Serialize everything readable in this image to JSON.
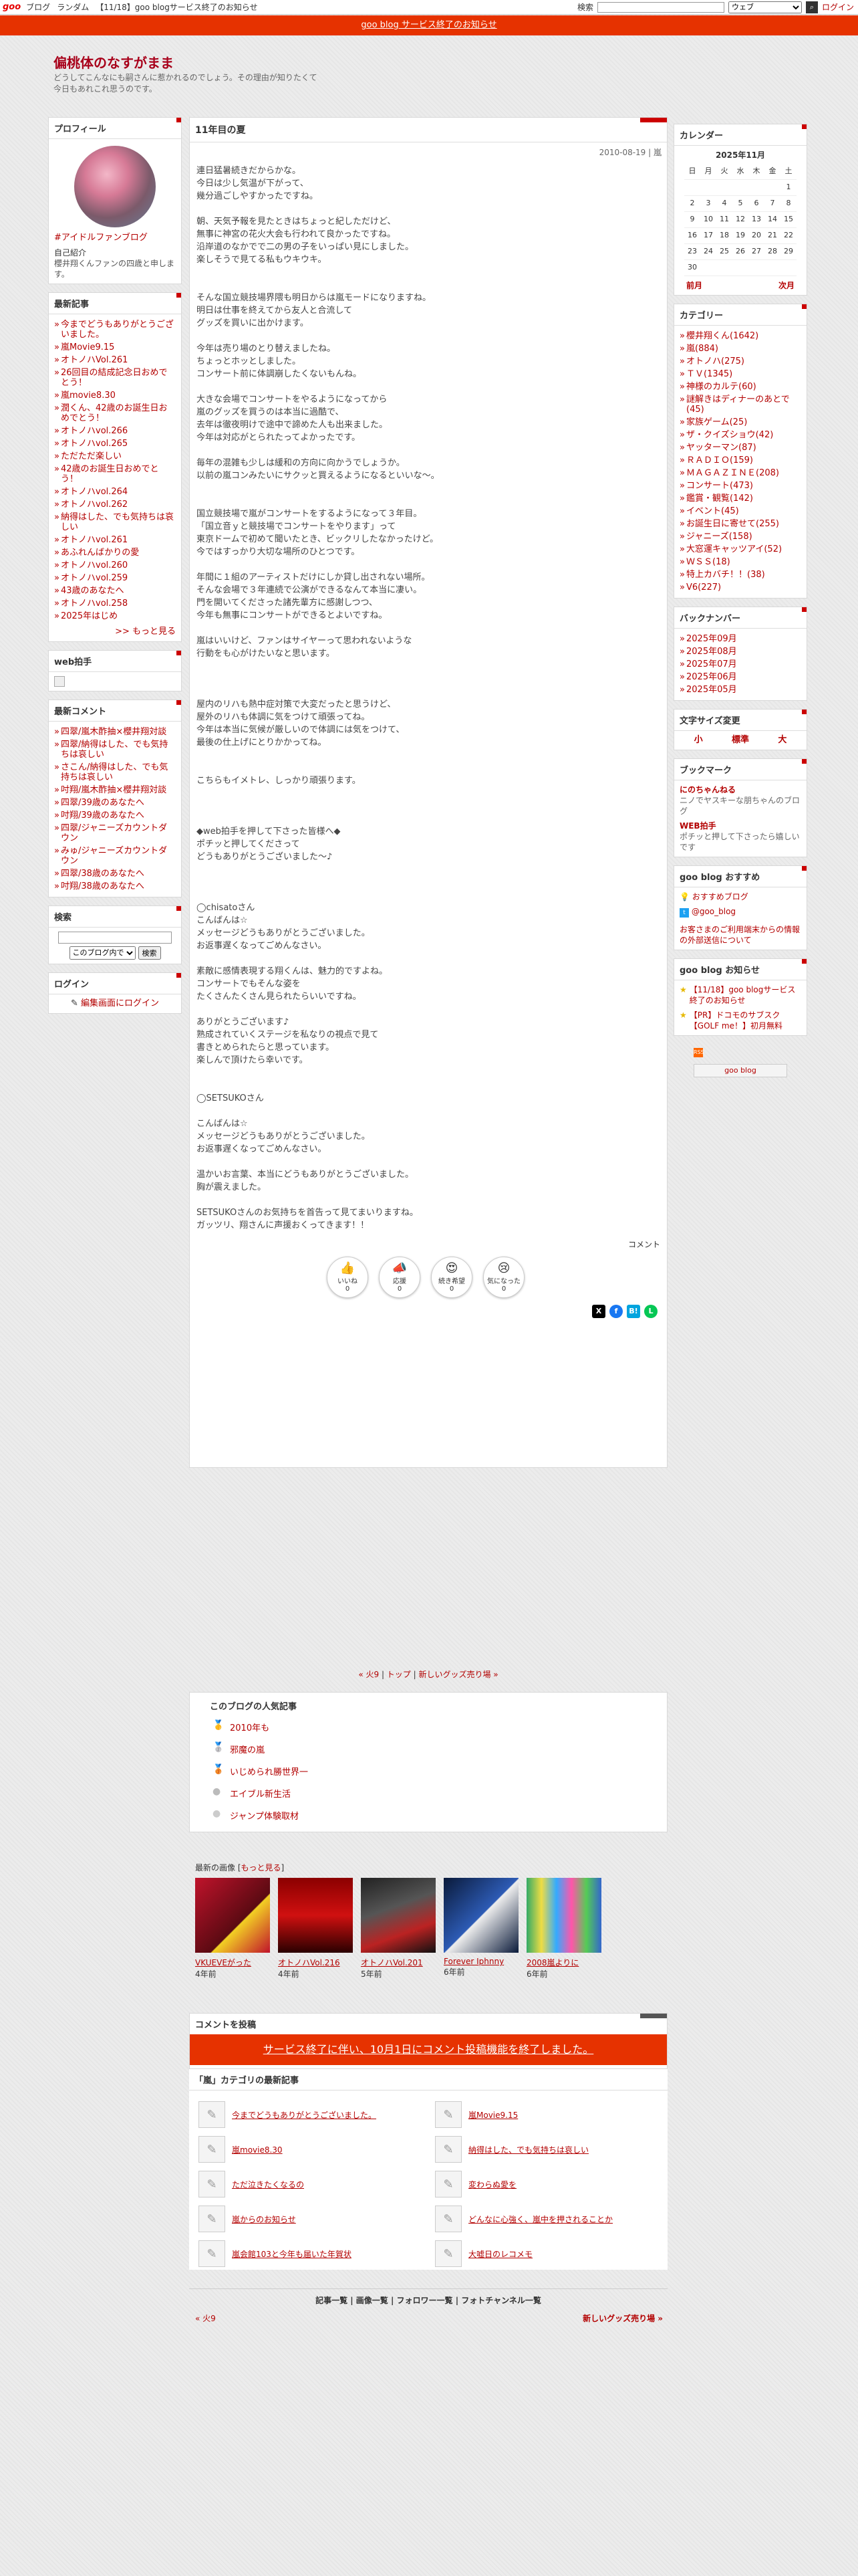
{
  "topbar": {
    "logo": "goo",
    "nav": [
      "ブログ",
      "ランダム",
      "【11/18】goo blogサービス終了のお知らせ"
    ],
    "search_label": "検索",
    "web_option": "ウェブ",
    "login": "ログイン"
  },
  "notice": "goo blog サービス終了のお知らせ",
  "blog": {
    "title": "偏桃体のなすがまま",
    "description": "どうしてこんなにも嗣さんに惹かれるのでしょう。その理由が知りたくて今日もあれこれ思うのです。"
  },
  "profile": {
    "heading": "プロフィール",
    "fanclub": "#アイドルファンブログ",
    "intro_heading": "自己紹介",
    "intro": "櫻井翔くんファンの四歳と申します。"
  },
  "latest": {
    "heading": "最新記事",
    "items": [
      "今までどうもありがとうございました。",
      "嵐Movie9.15",
      "オトノハVol.261",
      "26回目の結成記念日おめでとう！",
      "嵐movie8.30",
      "潤くん、42歳のお誕生日おめでとう！",
      "オトノハvol.266",
      "オトノハvol.265",
      "ただただ楽しい",
      "42歳のお誕生日おめでとう！",
      "オトノハvol.264",
      "オトノハvol.262",
      "納得はした、でも気持ちは哀しい",
      "オトノハvol.261",
      "あふれんばかりの愛",
      "オトノハvol.260",
      "オトノハvol.259",
      "43歳のあなたへ",
      "オトノハvol.258",
      "2025年はじめ"
    ],
    "more": ">> もっと見る"
  },
  "webclap": {
    "heading": "web拍手"
  },
  "recent_comments": {
    "heading": "最新コメント",
    "items": [
      "四翠/嵐木酢抽×櫻井翔対談",
      "四翠/納得はした、でも気持ちは哀しい",
      "さこん/納得はした、でも気持ちは哀しい",
      "吋翔/嵐木酢抽×櫻井翔対談",
      "四翠/39歳のあなたへ",
      "吋翔/39歳のあなたへ",
      "四翠/ジャニーズカウントダウン",
      "みゅ/ジャニーズカウントダウン",
      "四翠/38歳のあなたへ",
      "吋翔/38歳のあなたへ"
    ]
  },
  "search": {
    "heading": "検索",
    "option": "このブログ内で",
    "button": "検索"
  },
  "login": {
    "heading": "ログイン",
    "link": "編集画面にログイン"
  },
  "entry": {
    "title": "11年目の夏",
    "date": "2010-08-19 | 嵐",
    "lines": [
      "連日猛暑続きだからかな。",
      "今日は少し気温が下がって、",
      "幾分過ごしやすかったですね。",
      "",
      "朝、天気予報を見たときはちょっと紀しただけど、",
      "無事に神宮の花火大会も行われて良かったですね。",
      "沿岸道のなかでで二の男の子をいっぱい見にしました。",
      "楽しそうで見てる私もウキウキ。",
      "",
      "",
      "そんな国立競技場界隈も明日からは嵐モードになりますね。",
      "明日は仕事を終えてから友人と合流して",
      "グッズを買いに出かけます。",
      "",
      "今年は売り場のとり替えましたね。",
      "ちょっとホッとしました。",
      "コンサート前に体調崩したくないもんね。",
      "",
      "大きな会場でコンサートをやるようになってから",
      "嵐のグッズを買うのは本当に過酷で、",
      "去年は徹夜明けで途中で諦めた人も出来ました。",
      "今年は対応がとられたってよかったです。",
      "",
      "毎年の混雑も少しは緩和の方向に向かうでしょうか。",
      "以前の嵐コンみたいにサクッと買えるようになるといいな〜。",
      "",
      "",
      "国立競技場で嵐がコンサートをするようになって３年目。",
      "「国立音ｙと競技場でコンサートをやります」って",
      "東京ドームで初めて聞いたとき、ビックリしたなかったけど。",
      "今ではすっかり大切な場所のひとつです。",
      "",
      "年間に１組のアーティストだけにしか貸し出されない場所。",
      "そんな会場で３年連続で公演ができるなんて本当に凄い。",
      "門を開いてくださった諸先輩方に感謝しつつ、",
      "今年も無事にコンサートができるとよいですね。",
      "",
      "嵐はいいけど、ファンはサイヤーって思われないような",
      "行動をも心がけたいなと思います。",
      "",
      "",
      "",
      "屋内のリハも熱中症対策で大変だったと思うけど、",
      "屋外のリハも体調に気をつけて頑張ってね。",
      "今年は本当に気候が厳しいので体調には気をつけて、",
      "最後の仕上げにとりかかってね。",
      "",
      "",
      "こちらもイメトレ、しっかり頑張ります。",
      "",
      "",
      "",
      "◆web拍手を押して下さった皆様へ◆",
      "ポチッと押してくださって",
      "どうもありがとうございました〜♪",
      "",
      "",
      "",
      "◯chisatoさん",
      "こんばんは☆",
      "メッセージどうもありがとうございました。",
      "お返事遅くなってごめんなさい。",
      "",
      "素敵に感情表現する翔くんは、魅力的ですよね。",
      "コンサートでもそんな姿を",
      "たくさんたくさん見られたらいいですね。",
      "",
      "ありがとうございます♪",
      "熟成されていくステージを私なりの視点で見て",
      "書きとめられたらと思っています。",
      "楽しんで頂けたら幸いです。",
      "",
      "",
      "◯SETSUKOさん",
      "",
      "こんばんは☆",
      "メッセージどうもありがとうございました。",
      "お返事遅くなってごめんなさい。",
      "",
      "温かいお言葉、本当にどうもありがとうございました。",
      "胸が震えました。",
      "",
      "SETSUKOさんのお気持ちを首告って見てまいりますね。",
      "ガッツリ、翔さんに声援おくってきます！！"
    ],
    "comment_label": "コメント",
    "reactions": [
      {
        "icon": "👍",
        "label": "いいね",
        "count": "0"
      },
      {
        "icon": "📣",
        "label": "応援",
        "count": "0"
      },
      {
        "icon": "😍",
        "label": "続き希望",
        "count": "0"
      },
      {
        "icon": "😢",
        "label": "気になった",
        "count": "0"
      }
    ]
  },
  "pager": {
    "prev": "« 火9",
    "top": "トップ",
    "next": "新しいグッズ売り場 »"
  },
  "ranking": {
    "heading": "このブログの人気記事",
    "items": [
      "2010年も",
      "邪魔の嵐",
      "いじめられ勝世界一",
      "エイブル新生活",
      "ジャンプ体験取材"
    ]
  },
  "images": {
    "heading": "最新の画像",
    "more": "もっと見る",
    "items": [
      {
        "title": "VKUEVEがった",
        "age": "4年前"
      },
      {
        "title": "オトノハVol.216",
        "age": "4年前"
      },
      {
        "title": "オトノハVol.201",
        "age": "5年前"
      },
      {
        "title": "Forever Iphnny",
        "age": "6年前"
      },
      {
        "title": "2008嵐よりに",
        "age": "6年前"
      }
    ]
  },
  "comment_post": {
    "heading": "コメントを投稿",
    "banner": "サービス終了に伴い、10月1日にコメント投稿機能を終了しました。"
  },
  "cat_latest": {
    "heading": "「嵐」カテゴリの最新記事",
    "items": [
      "今までどうもありがとうございました。",
      "嵐Movie9.15",
      "嵐movie8.30",
      "納得はした、でも気持ちは哀しい",
      "ただ泣きたくなるの",
      "変わらぬ愛を",
      "嵐からのお知らせ",
      "どんなに心強く、嵐中を押されることか",
      "嵐会館103と今年も届いた年賀状",
      "大嘘日のレコメモ"
    ]
  },
  "footer": {
    "links": "記事一覧 | 画像一覧 | フォロワー一覧 | フォトチャンネル一覧",
    "prev": "« 火9",
    "next": "新しいグッズ売り場 »"
  },
  "calendar": {
    "heading": "カレンダー",
    "month": "2025年11月",
    "dow": [
      "日",
      "月",
      "火",
      "水",
      "木",
      "金",
      "土"
    ],
    "rows": [
      [
        "",
        "",
        "",
        "",
        "",
        "",
        "1"
      ],
      [
        "2",
        "3",
        "4",
        "5",
        "6",
        "7",
        "8"
      ],
      [
        "9",
        "10",
        "11",
        "12",
        "13",
        "14",
        "15"
      ],
      [
        "16",
        "17",
        "18",
        "19",
        "20",
        "21",
        "22"
      ],
      [
        "23",
        "24",
        "25",
        "26",
        "27",
        "28",
        "29"
      ],
      [
        "30",
        "",
        "",
        "",
        "",
        "",
        ""
      ]
    ],
    "prev": "前月",
    "next": "次月"
  },
  "category": {
    "heading": "カテゴリー",
    "items": [
      "櫻井翔くん(1642)",
      "嵐(884)",
      "オトノハ(275)",
      "ＴＶ(1345)",
      "神様のカルテ(60)",
      "謎解きはディナーのあとで(45)",
      "家族ゲーム(25)",
      "ザ・クイズショウ(42)",
      "ヤッターマン(87)",
      "ＲＡＤＩＯ(159)",
      "ＭＡＧＡＺＩＮＥ(208)",
      "コンサート(473)",
      "鑑賞・観覧(142)",
      "イベント(45)",
      "お誕生日に寄せて(255)",
      "ジャニーズ(158)",
      "大窓運キャッツアイ(52)",
      "ＷＳＳ(18)",
      "特上カバチ！！(38)",
      "V6(227)"
    ]
  },
  "backnumber": {
    "heading": "バックナンバー",
    "items": [
      "2025年09月",
      "2025年08月",
      "2025年07月",
      "2025年06月",
      "2025年05月"
    ]
  },
  "fontsize": {
    "heading": "文字サイズ変更",
    "small": "小",
    "mid": "標準",
    "large": "大"
  },
  "bookmark": {
    "heading": "ブックマーク",
    "items": [
      {
        "title": "にのちゃんねる",
        "desc": "ニノでヤスキーな朋ちゃんのブログ"
      },
      {
        "title": "WEB拍手",
        "desc": "ポチッと押して下さったら嬉しいです"
      }
    ]
  },
  "recommend": {
    "heading": "goo blog おすすめ",
    "items": [
      "おすすめブログ",
      "@goo_blog"
    ],
    "notice": "お客さまのご利用端末からの情報の外部送信について"
  },
  "goo_notice": {
    "heading": "goo blog お知らせ",
    "items": [
      "【11/18】goo blogサービス終了のお知らせ",
      "【PR】ドコモのサブスク【GOLF me！】初月無料"
    ]
  },
  "rss": "RSS",
  "goo_badge": "goo blog",
  "colors": {
    "accent": "#b30000",
    "notice": "#e63200"
  }
}
